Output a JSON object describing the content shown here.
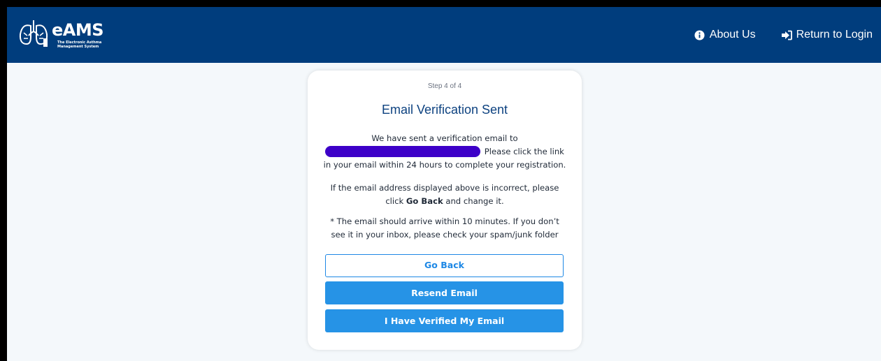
{
  "app": {
    "logo_title": "eAMS",
    "logo_subtitle": "The Electronic Asthma Management System"
  },
  "nav": {
    "about_label": "About Us",
    "about_icon": "info-circle-icon",
    "login_label": "Return to Login",
    "login_icon": "sign-in-icon"
  },
  "card": {
    "step": "Step 4 of 4",
    "title": "Email Verification Sent",
    "p1_before": "We have sent a verification email to",
    "p1_after": "Please click the link in your email within 24 hours to complete your registration.",
    "p2_before": "If the email address displayed above is incorrect, please click",
    "p2_bold": "Go Back",
    "p2_after": "and change it.",
    "p3": "* The email should arrive within 10 minutes. If you don’t see it in your inbox, please check your spam/junk folder"
  },
  "buttons": {
    "go_back": "Go Back",
    "resend": "Resend Email",
    "verified": "I Have Verified My Email"
  },
  "colors": {
    "navbar": "#003d7d",
    "title": "#0d4280",
    "primary_button": "#2693e6"
  }
}
